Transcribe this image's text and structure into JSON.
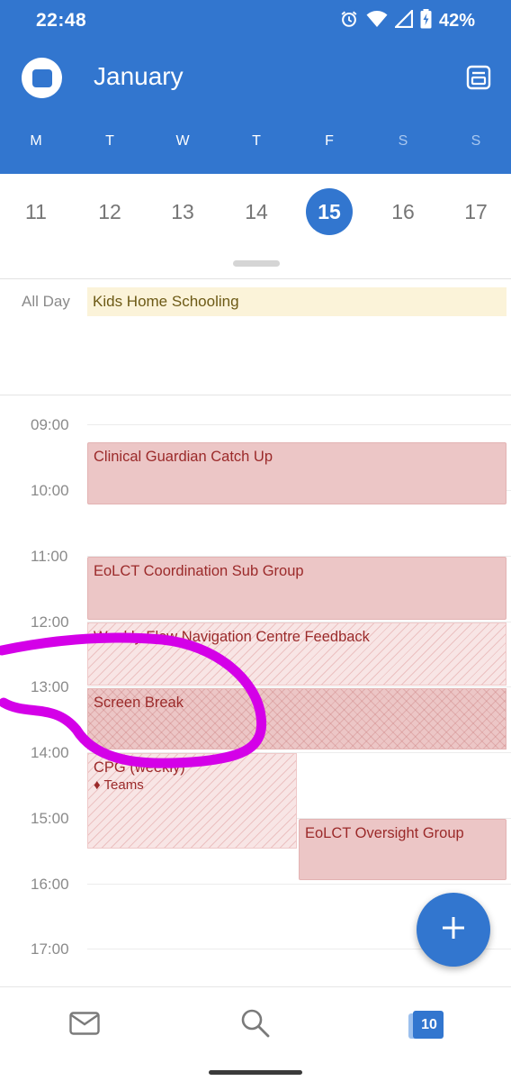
{
  "status_bar": {
    "time": "22:48",
    "battery": "42%",
    "icons": [
      "alarm-icon",
      "wifi-icon",
      "signal-icon",
      "battery-charging-icon"
    ]
  },
  "header": {
    "month": "January",
    "left_icon": "calendar-icon",
    "right_icon": "agenda-view-icon",
    "weekdays": [
      "M",
      "T",
      "W",
      "T",
      "F",
      "S",
      "S"
    ]
  },
  "date_strip": {
    "dates": [
      "11",
      "12",
      "13",
      "14",
      "15",
      "16",
      "17"
    ],
    "selected": "15"
  },
  "all_day": {
    "label": "All Day",
    "event": "Kids Home Schooling"
  },
  "timeline": {
    "hours": [
      "09:00",
      "10:00",
      "11:00",
      "12:00",
      "13:00",
      "14:00",
      "15:00",
      "16:00",
      "17:00"
    ],
    "events": [
      {
        "title": "Clinical Guardian Catch Up",
        "start": "09:15",
        "end": "10:15",
        "style": "solid"
      },
      {
        "title": "EoLCT Coordination Sub Group",
        "start": "11:00",
        "end": "12:00",
        "style": "solid"
      },
      {
        "title": "Weekly Flow Navigation Centre Feedback",
        "start": "12:00",
        "end": "13:00",
        "style": "tentative"
      },
      {
        "title": "Screen Break",
        "start": "13:00",
        "end": "14:00",
        "style": "cross"
      },
      {
        "title": "CPG (weekly)",
        "subtitle": "♦ Teams",
        "start": "14:00",
        "end": "15:30",
        "style": "tentative"
      },
      {
        "title": "EoLCT Oversight Group",
        "start": "15:00",
        "end": "16:00",
        "style": "solid"
      }
    ]
  },
  "colors": {
    "primary": "#3276cf",
    "event_text": "#9b2a2a",
    "event_bg": "#ecc6c6",
    "all_day_bg": "#fbf3d9",
    "annotation": "#d400e8"
  },
  "bottom_nav": {
    "items": [
      "mail-icon",
      "search-icon",
      "calendar-icon"
    ],
    "calendar_badge": "10"
  },
  "fab_icon": "plus-icon"
}
